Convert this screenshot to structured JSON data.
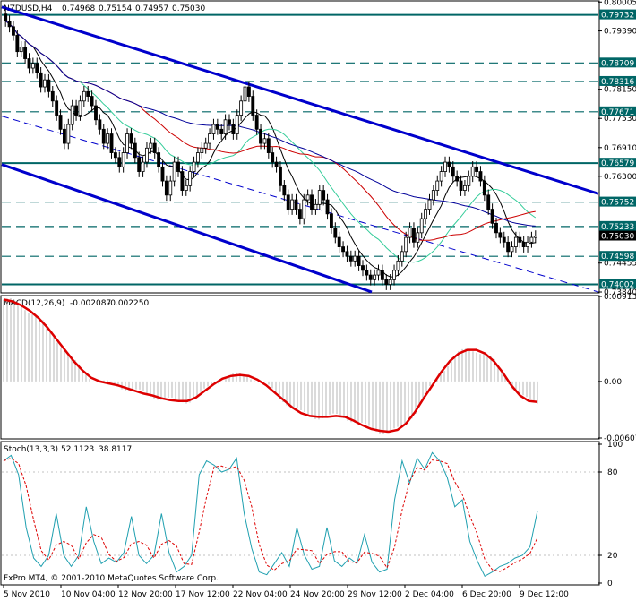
{
  "chart_data": [
    {
      "panel": "main",
      "type": "candlestick",
      "title": "NZDUSD,H4",
      "header_values": [
        "0.74968",
        "0.75154",
        "0.74957",
        "0.75030"
      ],
      "ylim": [
        0.7384,
        0.8001
      ],
      "y_ticks": [
        "0.80005",
        "0.79390",
        "0.78150",
        "0.77530",
        "0.76910",
        "0.76300",
        "0.75030",
        "0.74455",
        "0.73840"
      ],
      "x_labels": [
        "5 Nov 2010",
        "10 Nov 04:00",
        "12 Nov 20:00",
        "17 Nov 12:00",
        "22 Nov 04:00",
        "24 Nov 20:00",
        "29 Nov 12:00",
        "2 Dec 04:00",
        "6 Dec 20:00",
        "9 Dec 12:00"
      ],
      "close": [
        0.796,
        0.7948,
        0.793,
        0.7895,
        0.7905,
        0.788,
        0.786,
        0.787,
        0.785,
        0.782,
        0.7835,
        0.781,
        0.779,
        0.776,
        0.773,
        0.77,
        0.774,
        0.778,
        0.776,
        0.779,
        0.781,
        0.78,
        0.778,
        0.775,
        0.773,
        0.77,
        0.772,
        0.768,
        0.767,
        0.765,
        0.768,
        0.772,
        0.77,
        0.767,
        0.764,
        0.766,
        0.769,
        0.77,
        0.768,
        0.765,
        0.762,
        0.759,
        0.762,
        0.766,
        0.764,
        0.76,
        0.761,
        0.764,
        0.766,
        0.768,
        0.769,
        0.77,
        0.772,
        0.774,
        0.773,
        0.772,
        0.775,
        0.774,
        0.772,
        0.776,
        0.779,
        0.782,
        0.78,
        0.776,
        0.773,
        0.77,
        0.771,
        0.768,
        0.766,
        0.765,
        0.761,
        0.759,
        0.756,
        0.758,
        0.756,
        0.754,
        0.758,
        0.759,
        0.756,
        0.757,
        0.76,
        0.758,
        0.755,
        0.752,
        0.75,
        0.748,
        0.747,
        0.746,
        0.745,
        0.746,
        0.744,
        0.743,
        0.742,
        0.741,
        0.742,
        0.743,
        0.741,
        0.74,
        0.741,
        0.743,
        0.745,
        0.747,
        0.75,
        0.752,
        0.749,
        0.751,
        0.754,
        0.756,
        0.758,
        0.76,
        0.762,
        0.764,
        0.766,
        0.765,
        0.763,
        0.762,
        0.76,
        0.761,
        0.763,
        0.765,
        0.764,
        0.762,
        0.759,
        0.756,
        0.753,
        0.751,
        0.75,
        0.749,
        0.747,
        0.748,
        0.75,
        0.749,
        0.748,
        0.749,
        0.75,
        0.7503
      ],
      "support_resistance_levels": [
        {
          "price": 0.79732,
          "label": "0.79732",
          "style": "solid"
        },
        {
          "price": 0.78709,
          "label": "0.78709",
          "style": "dashed"
        },
        {
          "price": 0.78316,
          "label": "0.78316",
          "style": "dashed"
        },
        {
          "price": 0.77671,
          "label": "0.77671",
          "style": "dashed"
        },
        {
          "price": 0.76579,
          "label": "0.76579",
          "style": "solid"
        },
        {
          "price": 0.75752,
          "label": "0.75752",
          "style": "dashed"
        },
        {
          "price": 0.75233,
          "label": "0.75233",
          "style": "dashed"
        },
        {
          "price": 0.74598,
          "label": "0.74598",
          "style": "dashed"
        },
        {
          "price": 0.74002,
          "label": "0.74002",
          "style": "solid"
        }
      ],
      "current_price_label": "0.75030",
      "colors": {
        "trendline": "#0000cc",
        "level": "#006666",
        "ma_red": "#cc0000",
        "ma_green": "#33cc99",
        "ma_black": "#000000",
        "ma_navy": "#000099"
      }
    },
    {
      "panel": "macd",
      "type": "line",
      "label": "MACD(12,26,9)",
      "header_values": [
        "-0.002087",
        "-0.002250"
      ],
      "ylim": [
        -0.00607,
        0.00913
      ],
      "y_ticks": [
        "0.00913",
        "0.00",
        "-0.00607"
      ],
      "signal": [
        0.0088,
        0.0086,
        0.0082,
        0.0076,
        0.0068,
        0.0058,
        0.0046,
        0.0034,
        0.0022,
        0.0012,
        0.0004,
        0.0,
        -0.0002,
        -0.0004,
        -0.0007,
        -0.001,
        -0.0013,
        -0.0015,
        -0.0018,
        -0.002,
        -0.0021,
        -0.0021,
        -0.0017,
        -0.001,
        -0.0003,
        0.0003,
        0.0006,
        0.0007,
        0.0006,
        0.0002,
        -0.0004,
        -0.0012,
        -0.002,
        -0.0028,
        -0.0034,
        -0.0037,
        -0.0038,
        -0.0038,
        -0.0037,
        -0.0038,
        -0.0042,
        -0.0047,
        -0.0051,
        -0.0053,
        -0.0054,
        -0.0052,
        -0.0045,
        -0.0033,
        -0.0018,
        -0.0004,
        0.001,
        0.0022,
        0.003,
        0.0034,
        0.0034,
        0.003,
        0.0022,
        0.001,
        -0.0004,
        -0.0015,
        -0.0021,
        -0.0022
      ]
    },
    {
      "panel": "stochastic",
      "type": "line",
      "label": "Stoch(13,3,3)",
      "header_values": [
        "52.1123",
        "38.8117"
      ],
      "ylim": [
        0,
        100
      ],
      "y_ticks": [
        "100",
        "80",
        "20",
        "0"
      ],
      "main": [
        88,
        92,
        78,
        40,
        18,
        12,
        20,
        50,
        20,
        12,
        20,
        55,
        30,
        14,
        18,
        15,
        22,
        48,
        20,
        14,
        20,
        50,
        22,
        8,
        12,
        20,
        78,
        88,
        85,
        80,
        82,
        90,
        50,
        25,
        8,
        6,
        14,
        22,
        12,
        40,
        20,
        10,
        12,
        40,
        16,
        12,
        18,
        14,
        35,
        15,
        8,
        10,
        60,
        88,
        72,
        90,
        82,
        94,
        88,
        76,
        55,
        60,
        30,
        16,
        5,
        8,
        12,
        14,
        18,
        20,
        26,
        52
      ]
    }
  ],
  "footer": "FxPro MT4, © 2001-2010 MetaQuotes Software Corp."
}
